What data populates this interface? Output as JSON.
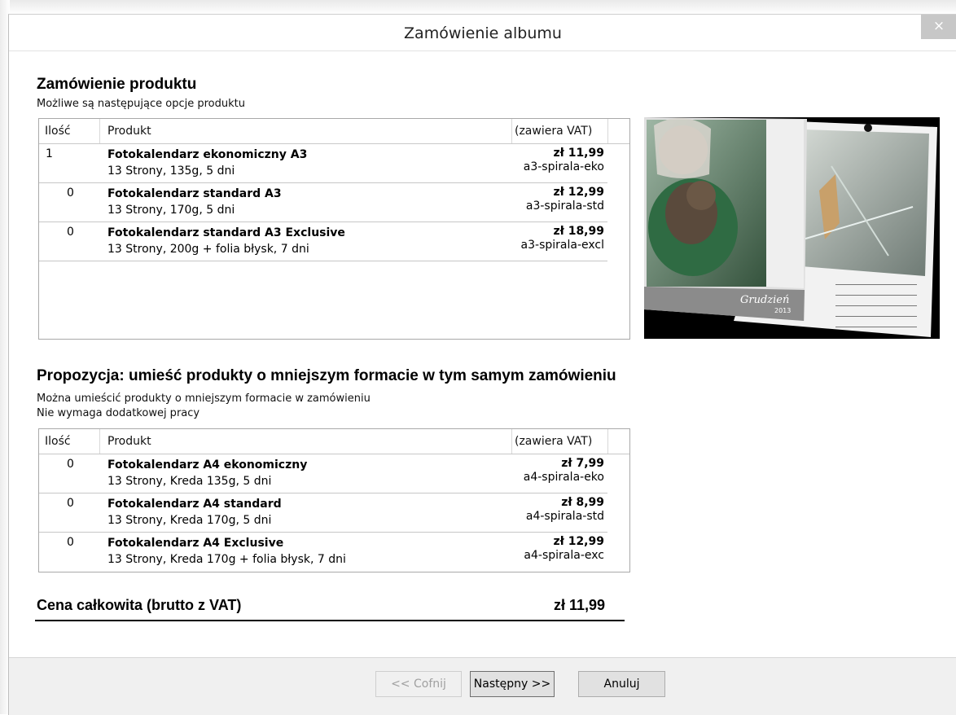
{
  "window": {
    "title": "Zamówienie albumu",
    "close_label": "×"
  },
  "product_section": {
    "title": "Zamówienie produktu",
    "subtitle": "Możliwe są następujące opcje produktu",
    "columns": {
      "qty": "Ilość",
      "product": "Produkt",
      "price": "(zawiera VAT)"
    },
    "rows": [
      {
        "qty": "1",
        "name": "Fotokalendarz ekonomiczny A3",
        "desc": "13 Strony, 135g, 5 dni",
        "price": "zł 11,99",
        "code": "a3-spirala-eko"
      },
      {
        "qty": "0",
        "name": "Fotokalendarz standard A3",
        "desc": "13 Strony, 170g, 5 dni",
        "price": "zł 12,99",
        "code": "a3-spirala-std"
      },
      {
        "qty": "0",
        "name": "Fotokalendarz standard A3 Exclusive",
        "desc": "13 Strony, 200g + folia błysk, 7 dni",
        "price": "zł 18,99",
        "code": "a3-spirala-excl"
      }
    ]
  },
  "preview": {
    "month_label": "Grudzień",
    "year_label": "2013"
  },
  "proposal_section": {
    "title": "Propozycja: umieść produkty o mniejszym formacie w tym samym zamówieniu",
    "line1": "Można umieścić produkty o mniejszym formacie w zamówieniu",
    "line2": "Nie wymaga dodatkowej pracy",
    "columns": {
      "qty": "Ilość",
      "product": "Produkt",
      "price": "(zawiera VAT)"
    },
    "rows": [
      {
        "qty": "0",
        "name": "Fotokalendarz A4 ekonomiczny",
        "desc": "13 Strony, Kreda 135g, 5 dni",
        "price": "zł 7,99",
        "code": "a4-spirala-eko"
      },
      {
        "qty": "0",
        "name": "Fotokalendarz A4 standard",
        "desc": "13 Strony, Kreda 170g, 5 dni",
        "price": "zł 8,99",
        "code": "a4-spirala-std"
      },
      {
        "qty": "0",
        "name": "Fotokalendarz A4 Exclusive",
        "desc": "13 Strony, Kreda 170g + folia błysk, 7 dni",
        "price": "zł 12,99",
        "code": "a4-spirala-exc"
      }
    ]
  },
  "total": {
    "label": "Cena całkowita (brutto z VAT)",
    "value": "zł 11,99"
  },
  "buttons": {
    "back": "<< Cofnij",
    "next": "Następny >>",
    "cancel": "Anuluj"
  }
}
